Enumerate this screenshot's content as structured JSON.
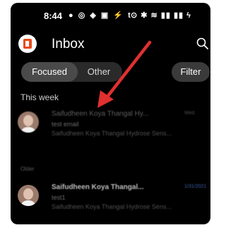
{
  "status_bar": {
    "time": "8:44",
    "left_icons": "● ◎ ◈ ▣ ⚡ t",
    "right_icons": "⊙ ✱ ≋ ▮▮ ▮▮ ϟ"
  },
  "header": {
    "title": "Inbox",
    "app_icon": "office-icon",
    "search_icon": "search-icon"
  },
  "tabs": {
    "focused": "Focused",
    "other": "Other",
    "filter": "Filter"
  },
  "sections": {
    "this_week": "This week",
    "older": "Older"
  },
  "emails": [
    {
      "sender": "Saifudheen Koya Thangal Hy...",
      "subject": "test email",
      "preview": "Saifudheen Koya Thangal Hydrose Sens...",
      "date": "Wed"
    },
    {
      "sender": "Saifudheen Koya Thangal...",
      "subject": "test1",
      "preview": "Saifudheen Koya Thangal Hydrose Sens...",
      "date": "1/31/2021"
    }
  ],
  "colors": {
    "accent_arrow": "#e03030",
    "office_brand": "#e84a1c",
    "date_highlight": "#3a62a8"
  }
}
